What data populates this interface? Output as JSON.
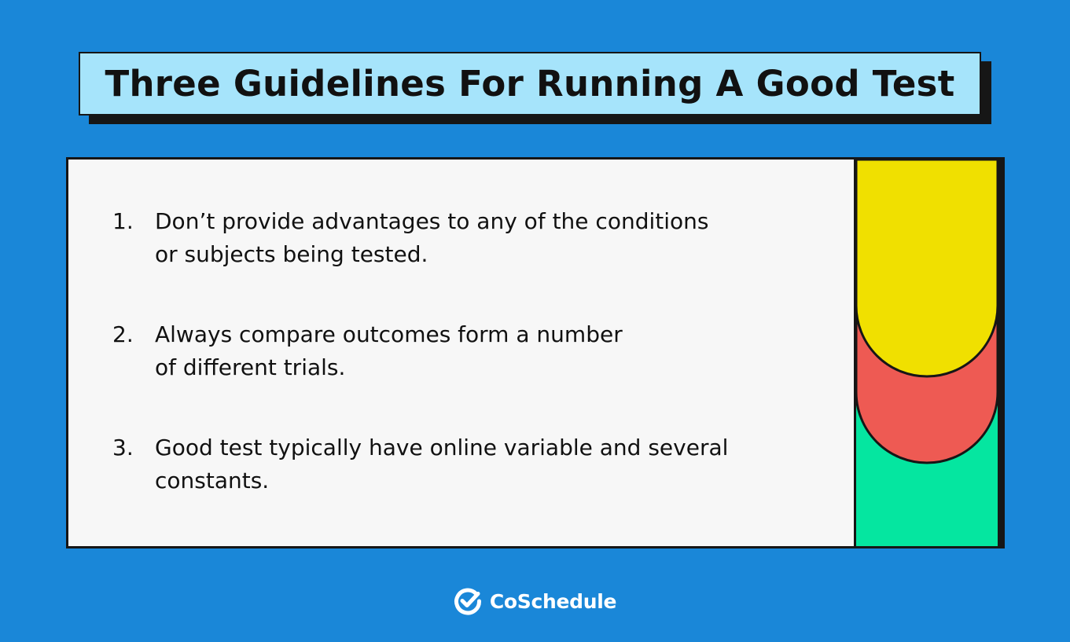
{
  "title": "Three Guidelines For Running A Good Test",
  "guidelines": [
    {
      "number": "1.",
      "text": "Don’t provide advantages to any of the conditions\nor subjects being tested."
    },
    {
      "number": "2.",
      "text": "Always compare outcomes form a number\nof different trials."
    },
    {
      "number": "3.",
      "text": "Good test typically have online variable and several\nconstants."
    }
  ],
  "decoration": {
    "colors": [
      "#f0e000",
      "#ee5a53",
      "#05e6a0"
    ]
  },
  "brand": {
    "name": "CoSchedule",
    "icon": "checkmark-circle-icon"
  },
  "colors": {
    "background": "#1a87d8",
    "title_background": "#a6e4fb",
    "card_background": "#f7f7f7"
  }
}
